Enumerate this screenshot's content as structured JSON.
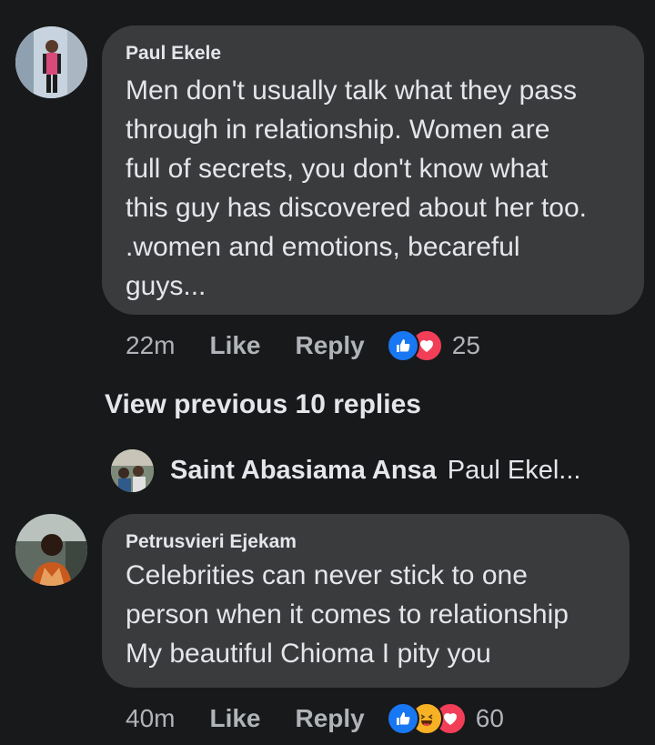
{
  "comments": [
    {
      "author": "Paul Ekele",
      "lines": [
        "Men don't usually talk what they pass",
        "through in relationship.  Women are",
        "full of secrets,  you don't know what",
        "this guy has discovered about her too.",
        ".women and emotions,  becareful",
        "guys..."
      ],
      "time": "22m",
      "like_label": "Like",
      "reply_label": "Reply",
      "reactions": [
        "like-reaction",
        "love-reaction"
      ],
      "reaction_count": "25"
    },
    {
      "author": "Petrusvieri Ejekam",
      "lines": [
        "Celebrities can never stick to one",
        "person when it comes to relationship",
        "My beautiful Chioma I pity you"
      ],
      "time": "40m",
      "like_label": "Like",
      "reply_label": "Reply",
      "reactions": [
        "like-reaction",
        "haha-reaction",
        "love-reaction"
      ],
      "reaction_count": "60"
    }
  ],
  "view_previous": "View previous 10 replies",
  "latest_reply": {
    "author": "Saint Abasiama Ansa",
    "preview": "Paul Ekel..."
  },
  "colors": {
    "background": "#18191a",
    "bubble": "#3a3b3c",
    "text": "#e4e6eb",
    "muted": "#b0b3b8",
    "like_blue": "#1877f2",
    "love_red": "#f33e58",
    "haha_yellow": "#f7b125"
  }
}
